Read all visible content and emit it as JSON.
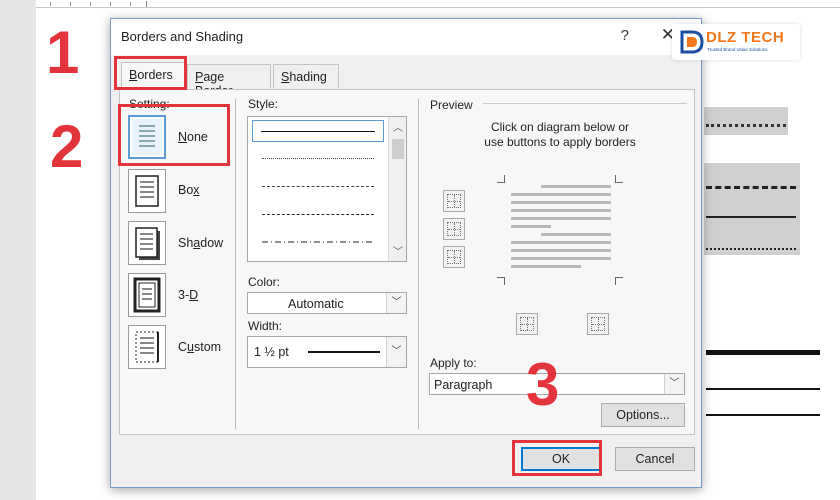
{
  "dialog": {
    "title": "Borders and Shading",
    "help_label": "?",
    "close_label": "✕",
    "tabs": [
      {
        "label": "Borders",
        "accesskey": "B",
        "rest": "orders"
      },
      {
        "label": "Page Border",
        "accesskey": "P",
        "rest": "age Border"
      },
      {
        "label": "Shading",
        "accesskey": "S",
        "rest": "hading"
      }
    ],
    "setting": {
      "label": "Setting:",
      "items": [
        {
          "label": "None",
          "accesskey": "N",
          "rest": "one",
          "selected": true
        },
        {
          "label": "Box",
          "accesskey": "x",
          "pre": "Bo",
          "selected": false
        },
        {
          "label": "Shadow",
          "accesskey": "a",
          "pre": "Sh",
          "post": "dow",
          "selected": false
        },
        {
          "label": "3-D",
          "accesskey": "D",
          "pre": "3-",
          "selected": false
        },
        {
          "label": "Custom",
          "accesskey": "u",
          "pre": "C",
          "post": "stom",
          "selected": false
        }
      ]
    },
    "style": {
      "label": "Style:",
      "accesskey": "Y",
      "rest": "Style:",
      "options": [
        "solid",
        "dotted",
        "dashed-fine",
        "dashed",
        "dash-dot"
      ]
    },
    "color": {
      "label": "Color:",
      "value": "Automatic"
    },
    "width": {
      "label": "Width:",
      "value": "1 ½ pt"
    },
    "preview": {
      "label": "Preview",
      "hint_line1": "Click on diagram below or",
      "hint_line2": "use buttons to apply borders"
    },
    "apply_to": {
      "label": "Apply to:",
      "value": "Paragraph"
    },
    "options_button": "Options...",
    "ok_button": "OK",
    "cancel_button": "Cancel"
  },
  "annotations": {
    "step1": "1",
    "step2": "2",
    "step3": "3",
    "color": "#e3343b"
  },
  "logo": {
    "text": "DLZ TECH",
    "subtitle": "Trusted Brand Value Solutions",
    "icons": [
      "dlz-logo-icon"
    ]
  },
  "icons": [
    "help-icon",
    "close-icon",
    "chevron-down-icon",
    "chevron-up-icon",
    "border-top-icon",
    "border-middle-icon",
    "border-bottom-icon",
    "border-left-icon",
    "border-right-icon"
  ]
}
